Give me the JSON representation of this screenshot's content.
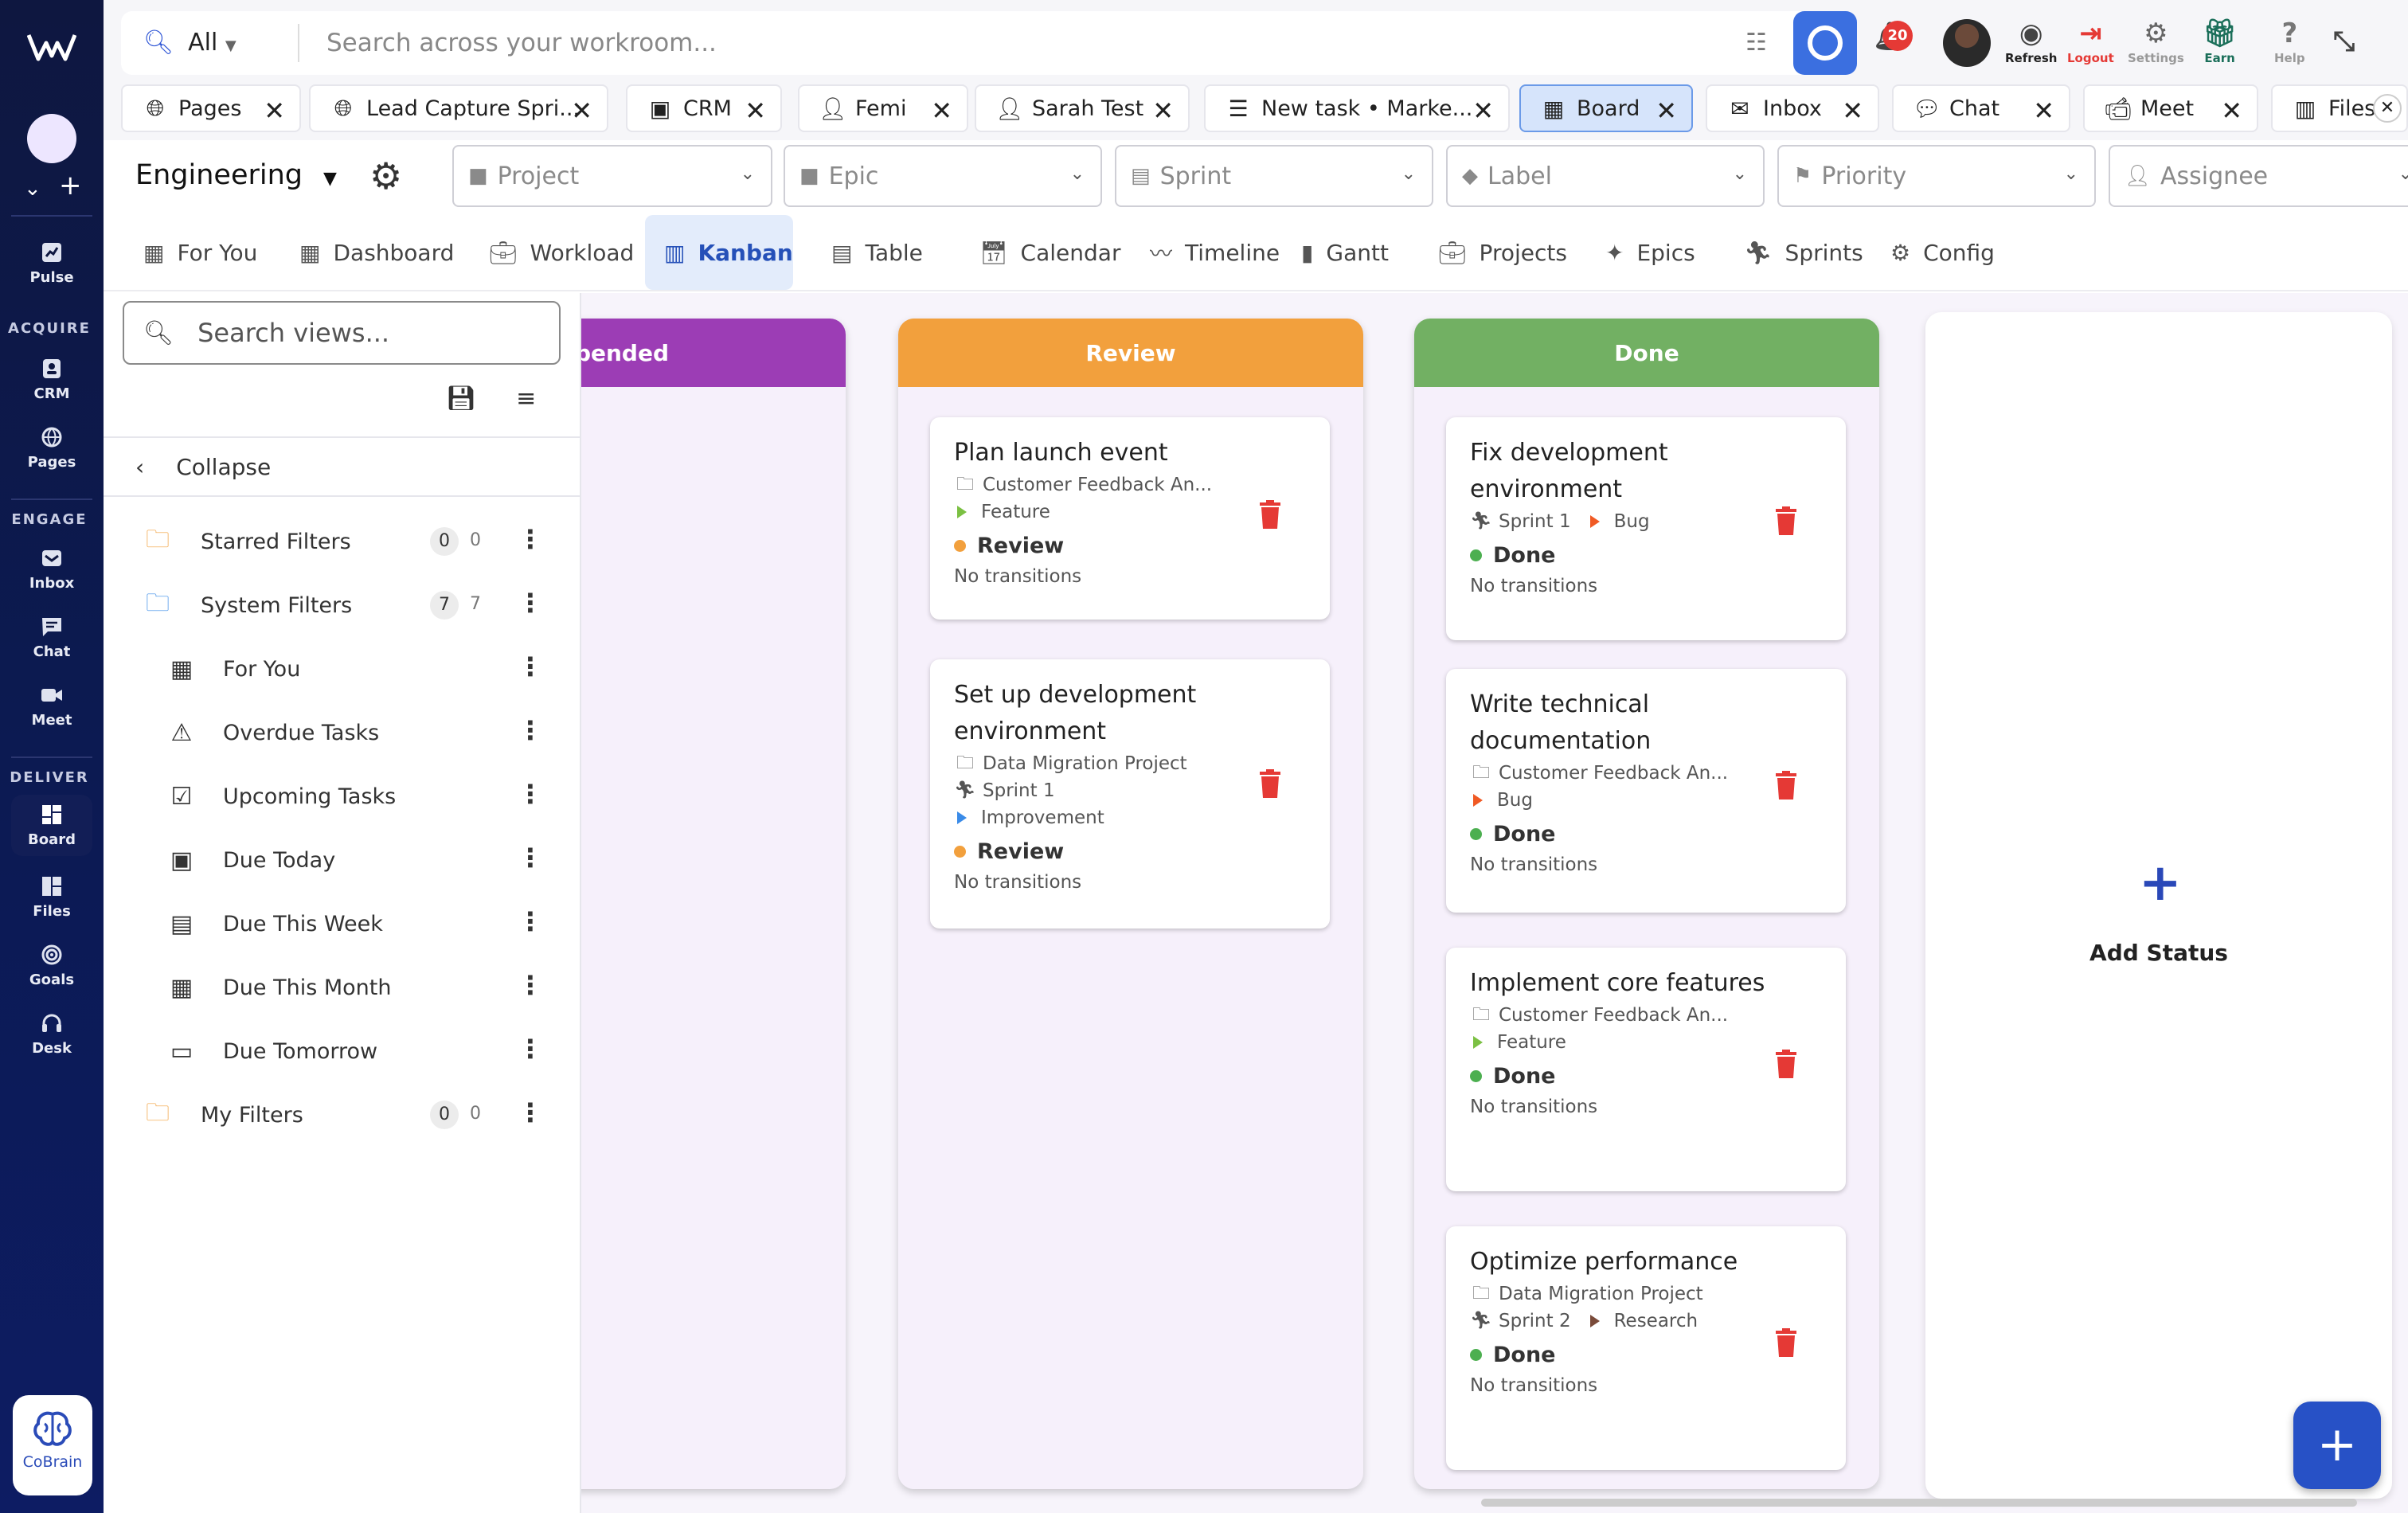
{
  "search": {
    "scope": "All",
    "placeholder": "Search across your workroom..."
  },
  "header": {
    "notifications_count": "20",
    "actions": [
      {
        "label": "Refresh",
        "icon": "refresh-icon"
      },
      {
        "label": "Logout",
        "icon": "logout-icon"
      },
      {
        "label": "Settings",
        "icon": "gear-icon"
      },
      {
        "label": "Earn",
        "icon": "earn-icon"
      },
      {
        "label": "Help",
        "icon": "help-icon"
      }
    ]
  },
  "rail": {
    "items": [
      {
        "label": "Pulse"
      },
      {
        "label": "CRM"
      },
      {
        "label": "Pages"
      },
      {
        "label": "Inbox"
      },
      {
        "label": "Chat"
      },
      {
        "label": "Meet"
      },
      {
        "label": "Board"
      },
      {
        "label": "Files"
      },
      {
        "label": "Goals"
      },
      {
        "label": "Desk"
      }
    ],
    "sections": [
      "ACQUIRE",
      "ENGAGE",
      "DELIVER"
    ],
    "cobrain_label": "CoBrain"
  },
  "open_tabs": [
    {
      "label": "Pages"
    },
    {
      "label": "Lead Capture Spri..."
    },
    {
      "label": "CRM"
    },
    {
      "label": "Femi"
    },
    {
      "label": "Sarah Test"
    },
    {
      "label": "New task • Marke..."
    },
    {
      "label": "Board"
    },
    {
      "label": "Inbox"
    },
    {
      "label": "Chat"
    },
    {
      "label": "Meet"
    },
    {
      "label": "Files"
    }
  ],
  "workspace": {
    "name": "Engineering"
  },
  "filters": {
    "project": "Project",
    "epic": "Epic",
    "sprint": "Sprint",
    "label": "Label",
    "priority": "Priority",
    "assignee": "Assignee"
  },
  "view_tabs": [
    {
      "label": "For You"
    },
    {
      "label": "Dashboard"
    },
    {
      "label": "Workload"
    },
    {
      "label": "Kanban"
    },
    {
      "label": "Table"
    },
    {
      "label": "Calendar"
    },
    {
      "label": "Timeline"
    },
    {
      "label": "Gantt"
    },
    {
      "label": "Projects"
    },
    {
      "label": "Epics"
    },
    {
      "label": "Sprints"
    },
    {
      "label": "Config"
    }
  ],
  "filter_panel": {
    "search_placeholder": "Search views...",
    "collapse_label": "Collapse",
    "starred": {
      "label": "Starred Filters",
      "count": "0",
      "count2": "0"
    },
    "system": {
      "label": "System Filters",
      "count": "7",
      "count2": "7"
    },
    "system_items": [
      {
        "label": "For You"
      },
      {
        "label": "Overdue Tasks"
      },
      {
        "label": "Upcoming Tasks"
      },
      {
        "label": "Due Today"
      },
      {
        "label": "Due This Week"
      },
      {
        "label": "Due This Month"
      },
      {
        "label": "Due Tomorrow"
      }
    ],
    "mine": {
      "label": "My Filters",
      "count": "0",
      "count2": "0"
    }
  },
  "board": {
    "columns": [
      {
        "title": "spended",
        "color": "#9c3db5"
      },
      {
        "title": "Review",
        "color": "#f2a03d",
        "cards": [
          {
            "title": "Plan launch event",
            "project": "Customer Feedback An...",
            "type": "Feature",
            "status": "Review",
            "transitions": "No transitions"
          },
          {
            "title": "Set up development environment",
            "project": "Data Migration Project",
            "sprint": "Sprint 1",
            "type": "Improvement",
            "status": "Review",
            "transitions": "No transitions"
          }
        ]
      },
      {
        "title": "Done",
        "color": "#72b063",
        "cards": [
          {
            "title": "Fix development environment",
            "sprint": "Sprint 1",
            "type": "Bug",
            "status": "Done",
            "transitions": "No transitions"
          },
          {
            "title": "Write technical documentation",
            "project": "Customer Feedback An...",
            "type": "Bug",
            "status": "Done",
            "transitions": "No transitions"
          },
          {
            "title": "Implement core features",
            "project": "Customer Feedback An...",
            "type": "Feature",
            "status": "Done",
            "transitions": "No transitions"
          },
          {
            "title": "Optimize performance",
            "project": "Data Migration Project",
            "sprint": "Sprint 2",
            "type": "Research",
            "status": "Done",
            "transitions": "No transitions"
          }
        ]
      }
    ],
    "add_status_label": "Add Status"
  },
  "colors": {
    "review_dot": "#f2a03d",
    "done_dot": "#4caf50",
    "trash": "#e53935",
    "accent": "#2751c6",
    "feature_tag": "#7bc043",
    "bug_tag": "#f05a24",
    "improvement_tag": "#3a8be8",
    "research_tag": "#7a4b3a"
  }
}
